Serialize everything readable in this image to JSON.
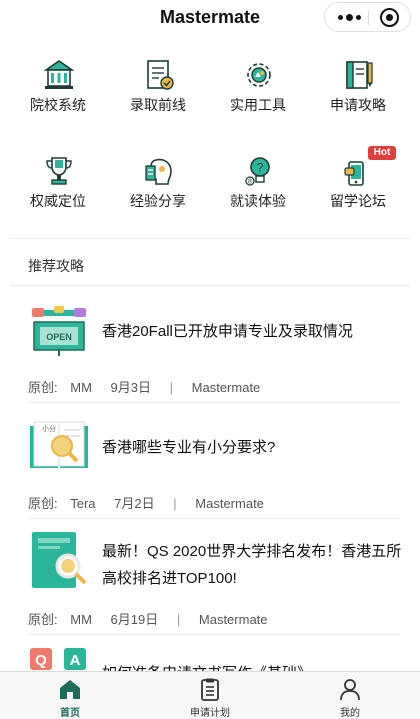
{
  "app": {
    "title": "Mastermate"
  },
  "grid": [
    {
      "label": "院校系统",
      "icon": "university-icon"
    },
    {
      "label": "录取前线",
      "icon": "admission-document-icon"
    },
    {
      "label": "实用工具",
      "icon": "gear-tools-icon"
    },
    {
      "label": "申请攻略",
      "icon": "guide-book-icon"
    },
    {
      "label": "权威定位",
      "icon": "trophy-icon"
    },
    {
      "label": "经验分享",
      "icon": "experience-share-icon"
    },
    {
      "label": "就读体验",
      "icon": "lightbulb-question-icon"
    },
    {
      "label": "留学论坛",
      "icon": "forum-chat-icon",
      "badge": "Hot"
    }
  ],
  "section": {
    "title": "推荐攻略"
  },
  "articles": [
    {
      "title": "香港20Fall已开放申请专业及录取情况",
      "type": "原创:",
      "author": "MM",
      "date": "9月3日",
      "sep": "|",
      "source": "Mastermate",
      "thumb_text": "OPEN"
    },
    {
      "title": "香港哪些专业有小分要求?",
      "type": "原创:",
      "author": "Tera",
      "date": "7月2日",
      "sep": "|",
      "source": "Mastermate",
      "thumb_text": "小分"
    },
    {
      "title": "最新！QS 2020世界大学排名发布！香港五所高校排名进TOP100!",
      "type": "原创:",
      "author": "MM",
      "date": "6月19日",
      "sep": "|",
      "source": "Mastermate"
    },
    {
      "title": "如何准备申请文书写作《基础》",
      "thumb_q": "Q",
      "thumb_a": "A"
    }
  ],
  "tabs": [
    {
      "label": "首页",
      "icon": "home-icon",
      "active": true
    },
    {
      "label": "申请计划",
      "icon": "clipboard-icon",
      "active": false
    },
    {
      "label": "我的",
      "icon": "user-icon",
      "active": false
    }
  ],
  "colors": {
    "accent": "#1f6a5a",
    "teal": "#2bb59a",
    "red": "#e0403a",
    "gold": "#e8b84a"
  }
}
